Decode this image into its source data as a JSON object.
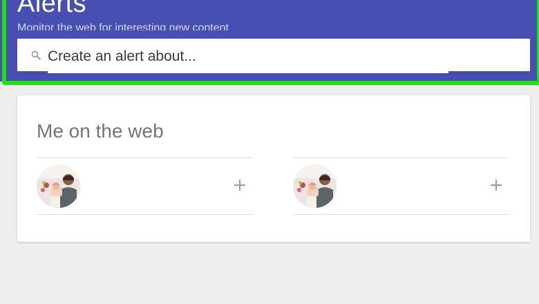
{
  "header": {
    "title": "Alerts",
    "subtitle": "Monitor the web for interesting new content"
  },
  "search": {
    "placeholder": "Create an alert about...",
    "icon": "search-icon"
  },
  "me_on_web": {
    "title": "Me on the web",
    "items": [
      {
        "avatar": "avatar",
        "action_icon": "add-icon"
      },
      {
        "avatar": "avatar",
        "action_icon": "add-icon"
      }
    ]
  },
  "colors": {
    "header_bg": "#474fb3",
    "highlight": "#1fe10d",
    "page_bg": "#eeeeee"
  }
}
